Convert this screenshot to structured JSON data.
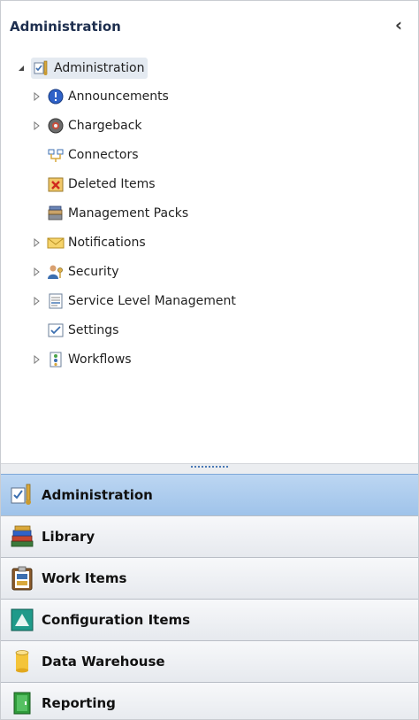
{
  "header": {
    "title": "Administration",
    "collapse_icon": "chevron-left-icon",
    "collapse_glyph": "‹"
  },
  "tree": {
    "root": {
      "label": "Administration",
      "icon": "administration-icon",
      "expanded": true
    },
    "items": [
      {
        "label": "Announcements",
        "icon": "info-icon",
        "has_children": true
      },
      {
        "label": "Chargeback",
        "icon": "chargeback-icon",
        "has_children": true
      },
      {
        "label": "Connectors",
        "icon": "connectors-icon",
        "has_children": false
      },
      {
        "label": "Deleted Items",
        "icon": "deleted-items-icon",
        "has_children": false
      },
      {
        "label": "Management Packs",
        "icon": "management-packs-icon",
        "has_children": false
      },
      {
        "label": "Notifications",
        "icon": "envelope-icon",
        "has_children": true
      },
      {
        "label": "Security",
        "icon": "security-users-icon",
        "has_children": true
      },
      {
        "label": "Service Level Management",
        "icon": "document-icon",
        "has_children": true
      },
      {
        "label": "Settings",
        "icon": "settings-checkbox-icon",
        "has_children": false
      },
      {
        "label": "Workflows",
        "icon": "workflows-icon",
        "has_children": true
      }
    ]
  },
  "wunderbar": [
    {
      "label": "Administration",
      "icon": "administration-icon",
      "active": true
    },
    {
      "label": "Library",
      "icon": "books-icon",
      "active": false
    },
    {
      "label": "Work Items",
      "icon": "clipboard-icon",
      "active": false
    },
    {
      "label": "Configuration Items",
      "icon": "triangle-icon",
      "active": false
    },
    {
      "label": "Data Warehouse",
      "icon": "database-icon",
      "active": false
    },
    {
      "label": "Reporting",
      "icon": "book-icon",
      "active": false
    }
  ],
  "colors": {
    "active_nav": "#a9cbee",
    "title_text": "#1e2f4f",
    "accent": "#3c6fb0"
  }
}
